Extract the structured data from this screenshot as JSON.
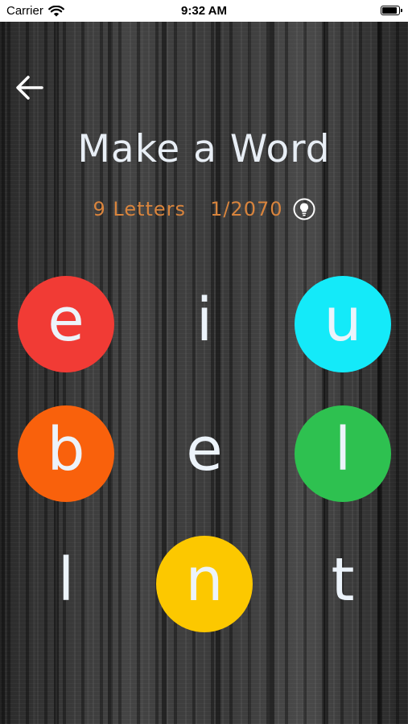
{
  "status_bar": {
    "carrier": "Carrier",
    "time": "9:32 AM",
    "battery_level": 0.95
  },
  "header": {
    "back_icon": "arrow-left-icon",
    "title": "Make a Word",
    "letters_label": "9 Letters",
    "progress": "1/2070",
    "hint_icon": "lightbulb-icon"
  },
  "board": {
    "tiles": [
      {
        "letter": "e",
        "color": "#f13b35"
      },
      {
        "letter": "i",
        "color": ""
      },
      {
        "letter": "u",
        "color": "#14eaf9"
      },
      {
        "letter": "b",
        "color": "#f9610c"
      },
      {
        "letter": "e",
        "color": ""
      },
      {
        "letter": "l",
        "color": "#2ec150"
      },
      {
        "letter": "l",
        "color": ""
      },
      {
        "letter": "n",
        "color": "#fcc800"
      },
      {
        "letter": "t",
        "color": ""
      }
    ]
  },
  "colors": {
    "title": "#e8eef5",
    "accent": "#d8843d",
    "letter": "#ecf3fa"
  }
}
